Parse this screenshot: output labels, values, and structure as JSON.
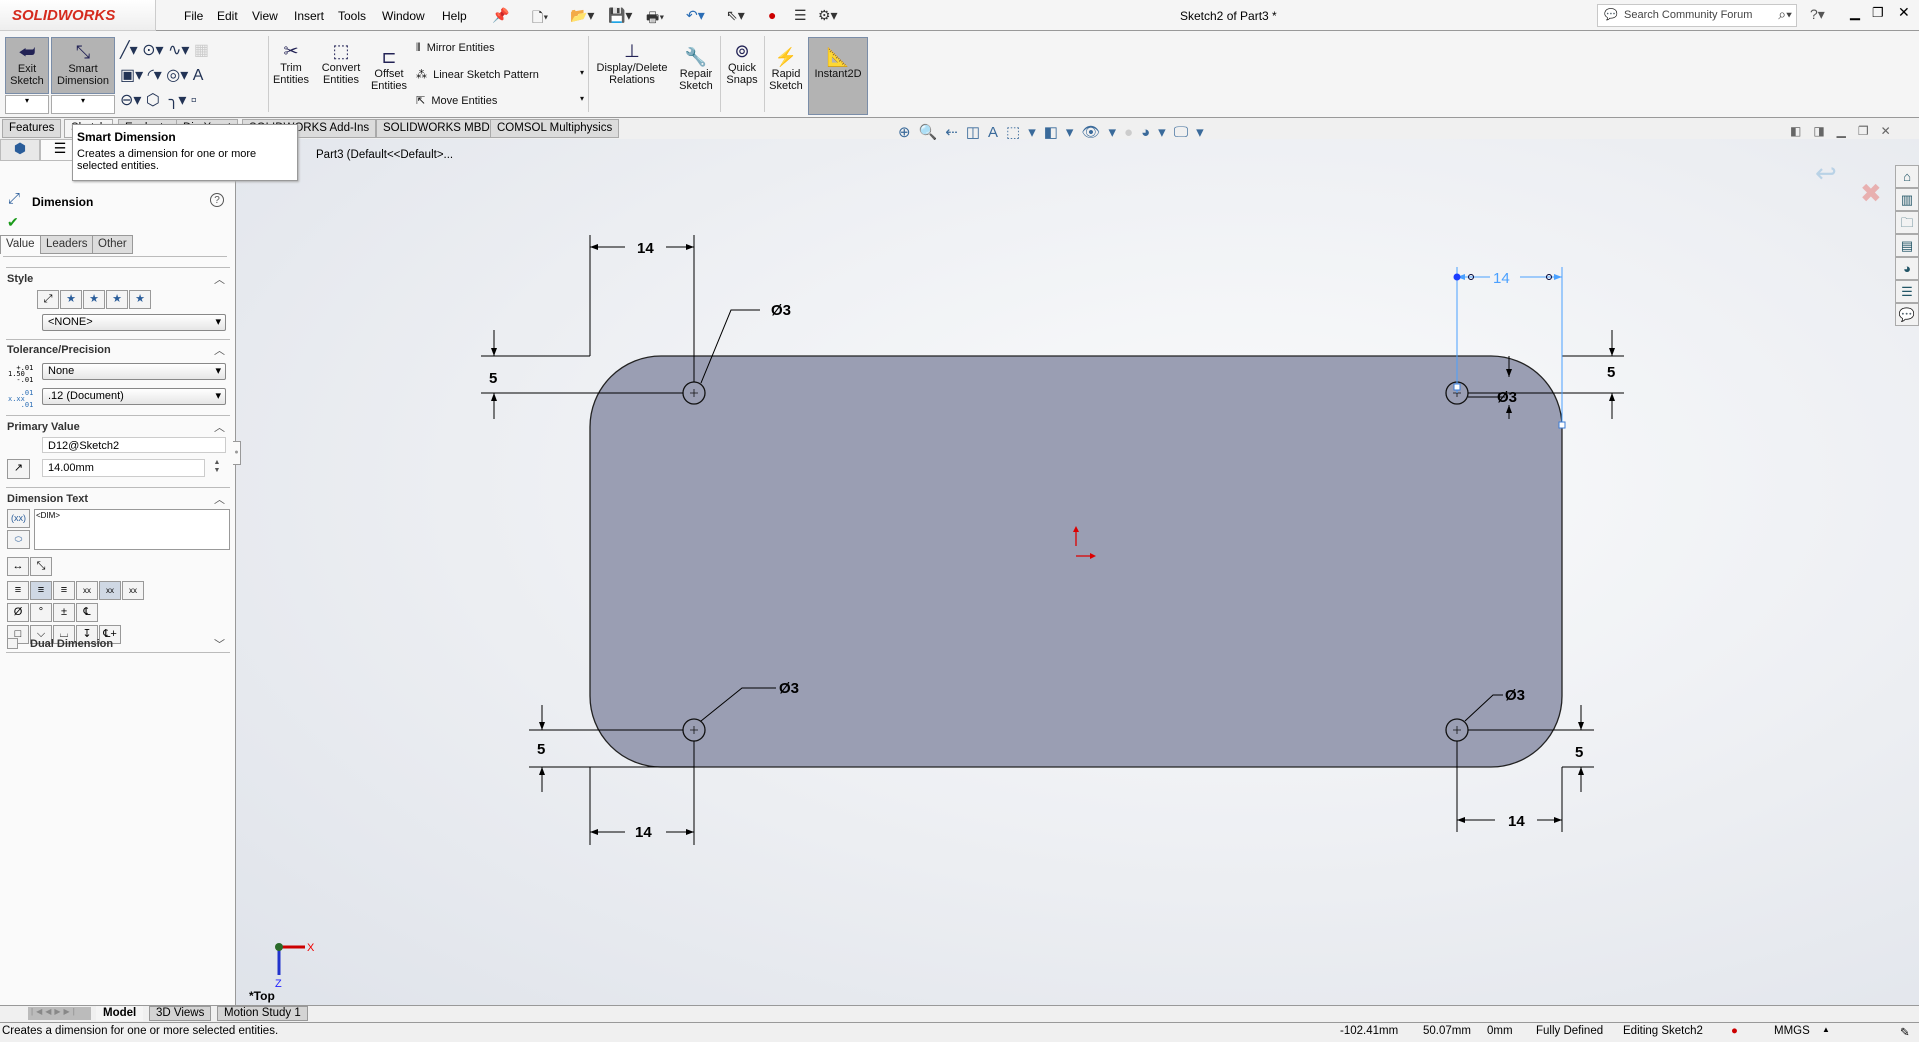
{
  "app": {
    "logo": "SOLIDWORKS",
    "title": "Sketch2 of Part3 *",
    "search_placeholder": "Search Community Forum"
  },
  "menu": [
    "File",
    "Edit",
    "View",
    "Insert",
    "Tools",
    "Window",
    "Help"
  ],
  "ribbon": {
    "exit_sketch": "Exit Sketch",
    "smart_dimension": "Smart Dimension",
    "trim": "Trim Entities",
    "convert": "Convert Entities",
    "offset": "Offset Entities",
    "mirror": "Mirror Entities",
    "linear_pattern": "Linear Sketch Pattern",
    "move": "Move Entities",
    "display_delete": "Display/Delete Relations",
    "repair": "Repair Sketch",
    "quick_snaps": "Quick Snaps",
    "rapid": "Rapid Sketch",
    "instant2d": "Instant2D"
  },
  "command_tabs": [
    "Features",
    "Sketch",
    "Evaluate",
    "DimXpert",
    "SOLIDWORKS Add-Ins",
    "SOLIDWORKS MBD",
    "COMSOL Multiphysics"
  ],
  "tooltip": {
    "title": "Smart Dimension",
    "body": "Creates a dimension for one or more selected entities."
  },
  "breadcrumb": "Part3  (Default<<Default>...",
  "panel": {
    "title": "Dimension",
    "tabs": [
      "Value",
      "Leaders",
      "Other"
    ],
    "style": {
      "header": "Style",
      "value": "<NONE>"
    },
    "tolerance": {
      "header": "Tolerance/Precision",
      "tolerance_type": "None",
      "precision": ".12 (Document)"
    },
    "primary": {
      "header": "Primary Value",
      "name": "D12@Sketch2",
      "value": "14.00mm"
    },
    "dim_text": {
      "header": "Dimension Text",
      "value": "<DIM>"
    },
    "dual": {
      "label": "Dual Dimension",
      "checked": false
    }
  },
  "sketch": {
    "dimensions": {
      "top_left_width": "14",
      "top_right_width": "14",
      "bottom_left_width": "14",
      "bottom_right_width": "14",
      "left_top_offset": "5",
      "right_top_offset": "5",
      "left_bottom_offset": "5",
      "right_bottom_offset": "5"
    },
    "holes": {
      "top_left": "Ø3",
      "top_right": "Ø3",
      "bottom_left": "Ø3",
      "bottom_right": "Ø3"
    },
    "selected_dimension": "top_right_width",
    "view_label": "*Top",
    "axis_x": "X",
    "axis_z": "Z",
    "fill_color": "#9a9eb3",
    "selected_color": "#4aa0ff"
  },
  "bottom_tabs": [
    "Model",
    "3D Views",
    "Motion Study 1"
  ],
  "status": {
    "message": "Creates a dimension for one or more selected entities.",
    "x": "-102.41mm",
    "y": "50.07mm",
    "z": "0mm",
    "state": "Fully Defined",
    "editing": "Editing Sketch2",
    "units": "MMGS"
  }
}
